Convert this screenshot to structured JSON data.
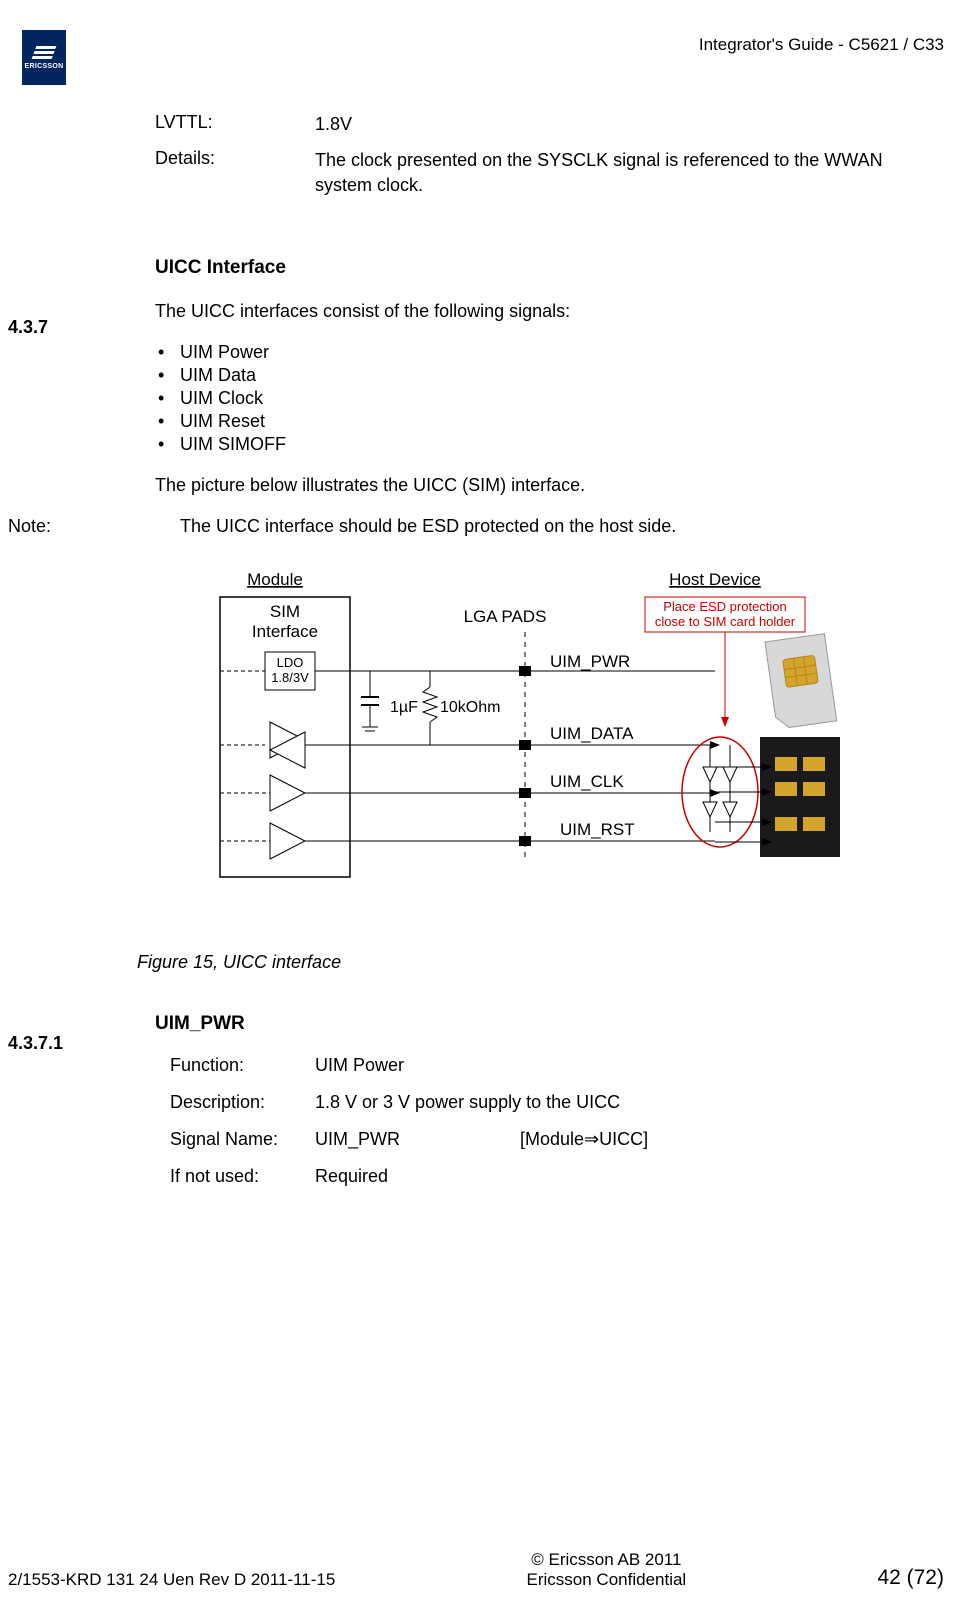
{
  "header": {
    "doc_title": "Integrator's Guide - C5621 / C33"
  },
  "logo": {
    "brand": "ERICSSON"
  },
  "kv1": {
    "label": "LVTTL:",
    "value": "1.8V"
  },
  "kv2": {
    "label": "Details:",
    "value": "The clock presented on the SYSCLK signal is referenced to the WWAN system clock."
  },
  "section": {
    "num": "4.3.7",
    "title": "UICC Interface",
    "intro": "The UICC interfaces consist of the following signals:",
    "bullets": [
      "UIM Power",
      "UIM Data",
      "UIM Clock",
      "UIM Reset",
      "UIM SIMOFF"
    ],
    "post": "The picture below illustrates the UICC (SIM) interface.",
    "note_label": "Note:",
    "note_text": "The UICC interface should be ESD protected on the host side."
  },
  "figure": {
    "caption": "Figure 15, UICC interface",
    "labels": {
      "module": "Module",
      "host": "Host Device",
      "sim_if_1": "SIM",
      "sim_if_2": "Interface",
      "ldo_1": "LDO",
      "ldo_2": "1.8/3V",
      "lga": "LGA PADS",
      "esd_1": "Place ESD protection",
      "esd_2": "close to SIM card holder",
      "cap": "1µF",
      "res": "10kOhm",
      "sig_pwr": "UIM_PWR",
      "sig_data": "UIM_DATA",
      "sig_clk": "UIM_CLK",
      "sig_rst": "UIM_RST"
    }
  },
  "subsection": {
    "num": "4.3.7.1",
    "title": "UIM_PWR",
    "rows": {
      "function": {
        "label": "Function:",
        "value": "UIM Power"
      },
      "description": {
        "label": "Description:",
        "value": "1.8 V or 3 V power supply to the UICC"
      },
      "signal": {
        "label": "Signal Name:",
        "value": "UIM_PWR",
        "dir": "[Module⇒UICC]"
      },
      "ifnot": {
        "label": "If not used:",
        "value": "Required"
      }
    }
  },
  "footer": {
    "left": "2/1553-KRD 131 24 Uen  Rev D    2011-11-15",
    "center_1": "© Ericsson AB 2011",
    "center_2": "Ericsson Confidential",
    "right": "42 (72)"
  }
}
